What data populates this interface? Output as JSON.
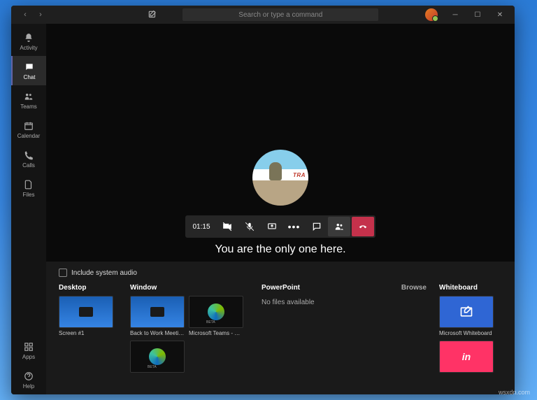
{
  "search": {
    "placeholder": "Search or type a command"
  },
  "rail": {
    "activity": "Activity",
    "chat": "Chat",
    "teams": "Teams",
    "calendar": "Calendar",
    "calls": "Calls",
    "files": "Files",
    "apps": "Apps",
    "help": "Help"
  },
  "call": {
    "timer": "01:15",
    "lonely": "You are the only one here."
  },
  "share": {
    "include_audio": "Include system audio",
    "desktop_header": "Desktop",
    "window_header": "Window",
    "powerpoint_header": "PowerPoint",
    "whiteboard_header": "Whiteboard",
    "browse": "Browse",
    "no_files": "No files available",
    "desktop_items": [
      "Screen #1"
    ],
    "window_items": [
      "Back to Work Meeting (M...",
      "Microsoft Teams - How t..."
    ],
    "whiteboard_items": [
      "Microsoft Whiteboard",
      "InVision"
    ]
  },
  "watermark": "wsxdn.com"
}
